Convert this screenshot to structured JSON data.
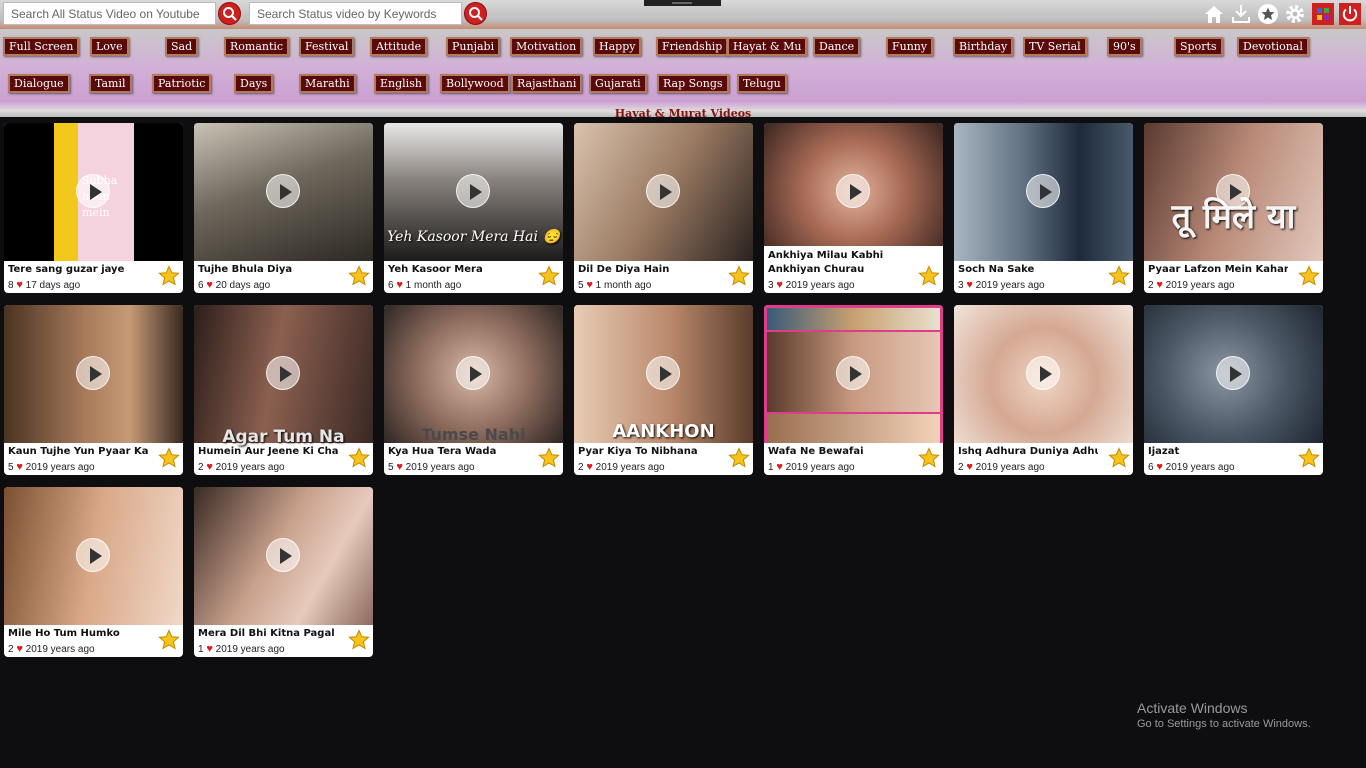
{
  "search": {
    "youtube_placeholder": "Search All Status Video on Youtube",
    "keyword_placeholder": "Search Status video by Keywords"
  },
  "toolbar_icons": [
    "home-icon",
    "download-icon",
    "favorites-icon",
    "gear-icon",
    "apps-icon",
    "power-icon"
  ],
  "colors": {
    "accent_red": "#d01f1f",
    "category_bg": "#5a0a0a",
    "heading_text": "#8a1010",
    "star": "#f6c21c"
  },
  "categories": {
    "row1": [
      "Full Screen",
      "Love",
      "Sad",
      "Romantic",
      "Festival",
      "Attitude",
      "Punjabi",
      "Motivation",
      "Happy",
      "Friendship",
      "Hayat & Mu",
      "Dance",
      "Funny",
      "Birthday",
      "TV Serial",
      "90's",
      "Sports",
      "Devotional"
    ],
    "row2": [
      "Dialogue",
      "Tamil",
      "Patriotic",
      "Days",
      "Marathi",
      "English",
      "Bollywood",
      "Rajasthani",
      "Gujarati",
      "Rap Songs",
      "Telugu"
    ]
  },
  "section_heading": "Hayat & Murat Videos",
  "videos": [
    {
      "title": "Tere sang guzar jaye",
      "likes": "8",
      "age": "17 days ago",
      "overlay": "Subha hoon mein"
    },
    {
      "title": "Tujhe Bhula Diya",
      "likes": "6",
      "age": "20 days ago",
      "overlay": ""
    },
    {
      "title": "Yeh Kasoor Mera",
      "likes": "6",
      "age": "1 month ago",
      "overlay": "Yeh Kasoor Mera Hai 😔"
    },
    {
      "title": "Dil De Diya Hain",
      "likes": "5",
      "age": "1 month ago",
      "overlay": ""
    },
    {
      "title": "Ankhiya Milau Kabhi Ankhiyan Churau",
      "likes": "3",
      "age": "2019 years ago",
      "overlay": ""
    },
    {
      "title": "Soch Na Sake",
      "likes": "3",
      "age": "2019 years ago",
      "overlay": ""
    },
    {
      "title": "Pyaar Lafzon Mein Kahan",
      "likes": "2",
      "age": "2019 years ago",
      "overlay": "तू मिले या"
    },
    {
      "title": "Kaun Tujhe Yun Pyaar Karega",
      "likes": "5",
      "age": "2019 years ago",
      "overlay": ""
    },
    {
      "title": "Humein Aur Jeene Ki Chahat",
      "likes": "2",
      "age": "2019 years ago",
      "overlay": "Agar Tum Na"
    },
    {
      "title": "Kya Hua Tera Wada",
      "likes": "5",
      "age": "2019 years ago",
      "overlay": "Tumse Nahi"
    },
    {
      "title": "Pyar Kiya To Nibhana",
      "likes": "2",
      "age": "2019 years ago",
      "overlay": "AANKHON"
    },
    {
      "title": "Wafa Ne Bewafai",
      "likes": "1",
      "age": "2019 years ago",
      "overlay": ""
    },
    {
      "title": "Ishq Adhura Duniya Adhuri",
      "likes": "2",
      "age": "2019 years ago",
      "overlay": ""
    },
    {
      "title": "Ijazat",
      "likes": "6",
      "age": "2019 years ago",
      "overlay": ""
    },
    {
      "title": "Mile Ho Tum Humko",
      "likes": "2",
      "age": "2019 years ago",
      "overlay": ""
    },
    {
      "title": "Mera Dil Bhi Kitna Pagal Hai",
      "likes": "1",
      "age": "2019 years ago",
      "overlay": ""
    }
  ],
  "watermark": {
    "line1": "Activate Windows",
    "line2": "Go to Settings to activate Windows."
  }
}
